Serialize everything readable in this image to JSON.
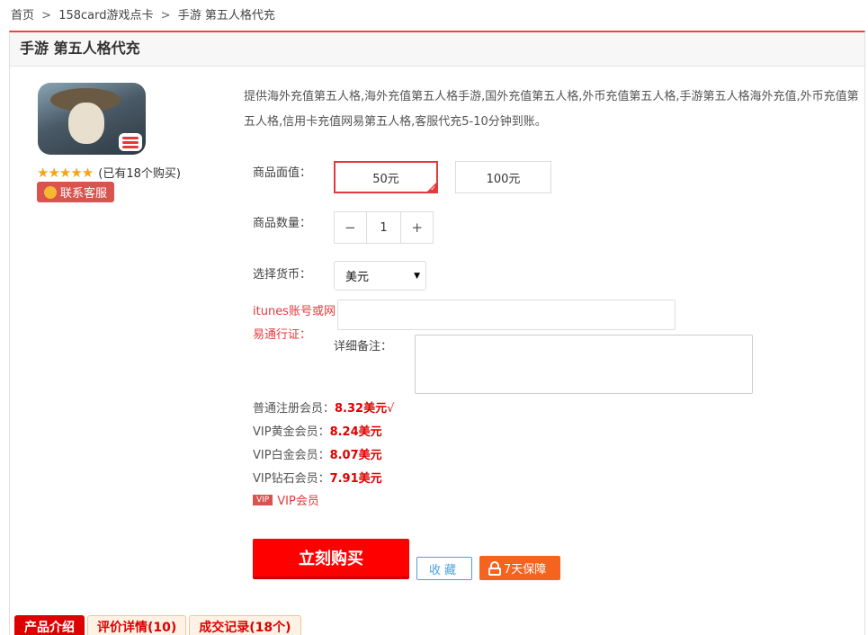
{
  "breadcrumb": {
    "home": "首页",
    "sep1": ">",
    "category": "158card游戏点卡",
    "sep2": ">",
    "current": "手游 第五人格代充"
  },
  "product": {
    "title": "手游 第五人格代充",
    "stars": "★★★★★",
    "buyers": "(已有18个购买)",
    "contact_label": "联系客服",
    "description": "提供海外充值第五人格,海外充值第五人格手游,国外充值第五人格,外币充值第五人格,手游第五人格海外充值,外币充值第五人格,信用卡充值网易第五人格,客服代充5-10分钟到账。"
  },
  "form": {
    "denomination_label": "商品面值：",
    "denominations": [
      "50元",
      "100元"
    ],
    "selected_denomination": "50元",
    "quantity_label": "商品数量：",
    "quantity": "1",
    "minus": "−",
    "plus": "+",
    "currency_label": "选择货币：",
    "currency": "美元",
    "account_label": "itunes账号或网易通行证：",
    "account_value": "",
    "notes_label": "详细备注：",
    "notes_value": ""
  },
  "pricing": [
    {
      "label": "普通注册会员：",
      "price": "8.32美元",
      "mark": "√"
    },
    {
      "label": "VIP黄金会员：",
      "price": "8.24美元",
      "mark": ""
    },
    {
      "label": "VIP白金会员：",
      "price": "8.07美元",
      "mark": ""
    },
    {
      "label": "VIP钻石会员：",
      "price": "7.91美元",
      "mark": ""
    }
  ],
  "vip": {
    "badge": "VIP",
    "label": "VIP会员"
  },
  "actions": {
    "buy": "立刻购买",
    "favorite": "收藏",
    "guarantee": "7天保障"
  },
  "tabs": [
    {
      "label": "产品介绍",
      "active": true
    },
    {
      "label": "评价详情(10)",
      "active": false
    },
    {
      "label": "成交记录(18个)",
      "active": false
    }
  ],
  "colors": {
    "accent_red": "#e4393c",
    "buy_red": "#ff0000",
    "guarantee_orange": "#f5641e",
    "favorite_blue": "#4aa3d8",
    "star_gold": "#f4a41c"
  }
}
